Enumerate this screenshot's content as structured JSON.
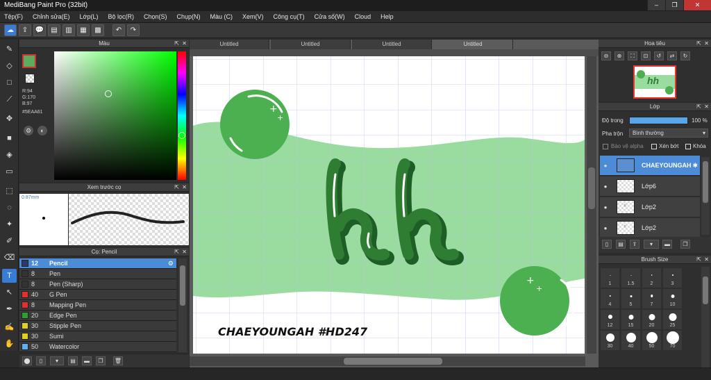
{
  "window": {
    "title": "MediBang Paint Pro (32bit)"
  },
  "menu": [
    "Tệp(F)",
    "Chỉnh sửa(E)",
    "Lớp(L)",
    "Bộ lọc(R)",
    "Chọn(S)",
    "Chụp(N)",
    "Màu (C)",
    "Xem(V)",
    "Công cụ(T)",
    "Cửa số(W)",
    "Cloud",
    "Help"
  ],
  "tabs": [
    "Untitled",
    "Untitled",
    "Untitled",
    "Untitled"
  ],
  "color_panel": {
    "title": "Màu",
    "r": "R:94",
    "g": "G:170",
    "b": "B:97",
    "hex": "#5EAA61",
    "current_color": "#5eaa61"
  },
  "brush_preview": {
    "title": "Xem trước cọ",
    "size": "0.87mm"
  },
  "brush_panel": {
    "title": "Cọ: Pencil",
    "brushes": [
      {
        "size": "12",
        "name": "Pencil",
        "color": "#2a3b6a"
      },
      {
        "size": "8",
        "name": "Pen",
        "color": "#333333"
      },
      {
        "size": "8",
        "name": "Pen (Sharp)",
        "color": "#333333"
      },
      {
        "size": "40",
        "name": "G Pen",
        "color": "#e03030"
      },
      {
        "size": "8",
        "name": "Mapping Pen",
        "color": "#e03030"
      },
      {
        "size": "20",
        "name": "Edge Pen",
        "color": "#2fa02f"
      },
      {
        "size": "30",
        "name": "Stipple Pen",
        "color": "#e0d020"
      },
      {
        "size": "30",
        "name": "Sumi",
        "color": "#e0d020"
      },
      {
        "size": "50",
        "name": "Watercolor",
        "color": "#5ab0f0"
      }
    ]
  },
  "canvas": {
    "caption": "CHAEYOUNGAH #HD247",
    "letters": "hh"
  },
  "navigator": {
    "title": "Hoa tiêu"
  },
  "layer_panel": {
    "title": "Lớp",
    "opacity_label": "Độ trong",
    "opacity_value": "100 %",
    "blend_label": "Pha trộn",
    "blend_value": "Bình thường",
    "protect_alpha": "Bảo vệ alpha",
    "clipping": "Xén bớt",
    "lock": "Khóa",
    "layers": [
      {
        "name": "CHAEYOUNGAH"
      },
      {
        "name": "Lớp6"
      },
      {
        "name": "Lớp2"
      },
      {
        "name": "Lớp2"
      }
    ]
  },
  "brush_size_panel": {
    "title": "Brush Size",
    "sizes": [
      "1",
      "1.5",
      "2",
      "3",
      "4",
      "5",
      "7",
      "10",
      "12",
      "15",
      "20",
      "25",
      "30",
      "40",
      "50",
      "70"
    ]
  }
}
